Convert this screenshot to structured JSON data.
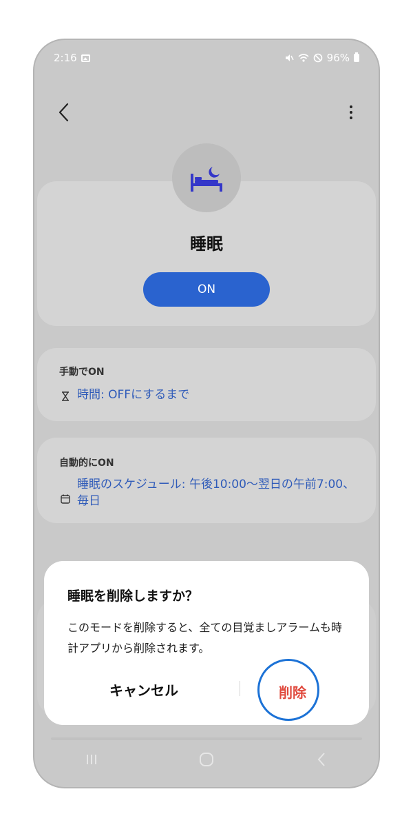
{
  "status_bar": {
    "time": "2:16",
    "battery": "96%"
  },
  "mode": {
    "title": "睡眠",
    "toggle_label": "ON",
    "accent_color": "#2a63cf"
  },
  "manual_on": {
    "label": "手動でON",
    "value": "時間: OFFにするまで"
  },
  "auto_on": {
    "label": "自動的にON",
    "value": "睡眠のスケジュール: 午後10:00〜翌日の午前7:00、 毎日"
  },
  "dialog": {
    "title": "睡眠を削除しますか？",
    "message": "このモードを削除すると、全ての目覚ましアラームも時計アプリから削除されます。",
    "cancel_label": "キャンセル",
    "delete_label": "削除",
    "delete_color": "#e0493d"
  },
  "icons": {
    "back": "chevron-left-icon",
    "more": "more-vertical-icon",
    "mode": "bed-moon-icon",
    "hourglass": "hourglass-icon",
    "calendar": "calendar-icon",
    "nav": [
      "recent-apps-icon",
      "home-icon",
      "back-icon"
    ]
  }
}
